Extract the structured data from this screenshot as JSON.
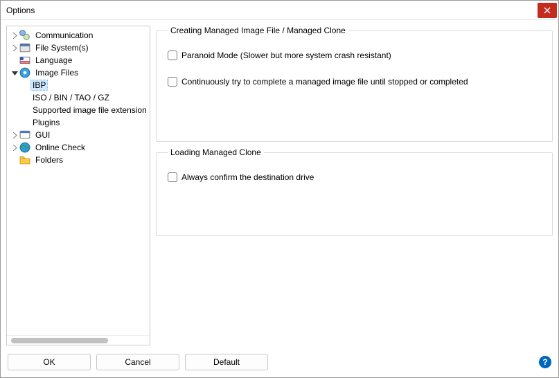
{
  "window": {
    "title": "Options"
  },
  "tree": {
    "items": [
      {
        "label": "Communication"
      },
      {
        "label": "File System(s)"
      },
      {
        "label": "Language"
      },
      {
        "label": "Image Files"
      },
      {
        "label": "IBP"
      },
      {
        "label": "ISO / BIN / TAO / GZ"
      },
      {
        "label": "Supported image file extension"
      },
      {
        "label": "Plugins"
      },
      {
        "label": "GUI"
      },
      {
        "label": "Online Check"
      },
      {
        "label": "Folders"
      }
    ]
  },
  "group1": {
    "legend": "Creating Managed Image File / Managed Clone",
    "opt1": "Paranoid Mode (Slower but more system crash resistant)",
    "opt2": "Continuously try to complete a managed image file until stopped or completed"
  },
  "group2": {
    "legend": "Loading Managed Clone",
    "opt1": "Always confirm the destination drive"
  },
  "buttons": {
    "ok": "OK",
    "cancel": "Cancel",
    "default": "Default",
    "help": "?"
  }
}
